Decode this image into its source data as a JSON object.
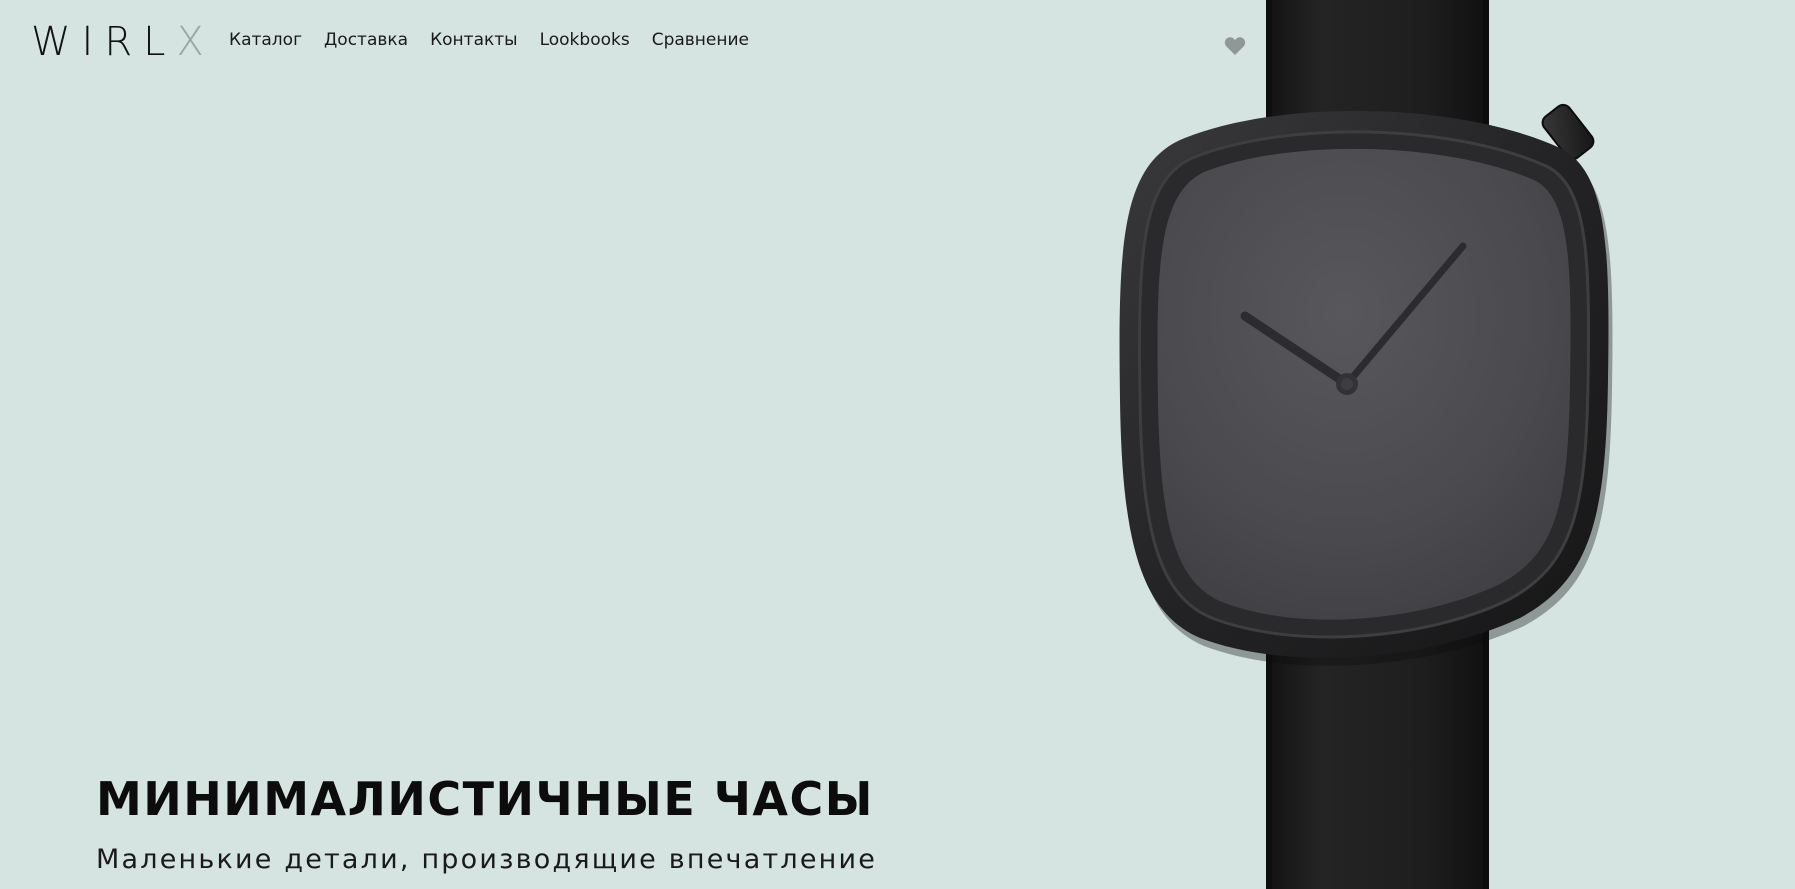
{
  "header": {
    "logo_main": "WIRL",
    "logo_accent": "X",
    "nav": [
      {
        "label": "Каталог"
      },
      {
        "label": "Доставка"
      },
      {
        "label": "Контакты"
      },
      {
        "label": "Lookbooks"
      },
      {
        "label": "Сравнение"
      }
    ],
    "favorites_icon": "heart-icon"
  },
  "hero": {
    "title": "МИНИМАЛИСТИЧНЫЕ ЧАСЫ",
    "subtitle": "Маленькие детали, производящие впечатление",
    "image": "black-minimalist-watch"
  },
  "colors": {
    "background": "#d5e4e0",
    "text": "#111111",
    "logo_accent": "#9aa6a3",
    "icon": "#8f9896",
    "watch_strap": "#1c1c1c",
    "watch_case": "#2b2b2d",
    "watch_dial": "#48484b"
  }
}
